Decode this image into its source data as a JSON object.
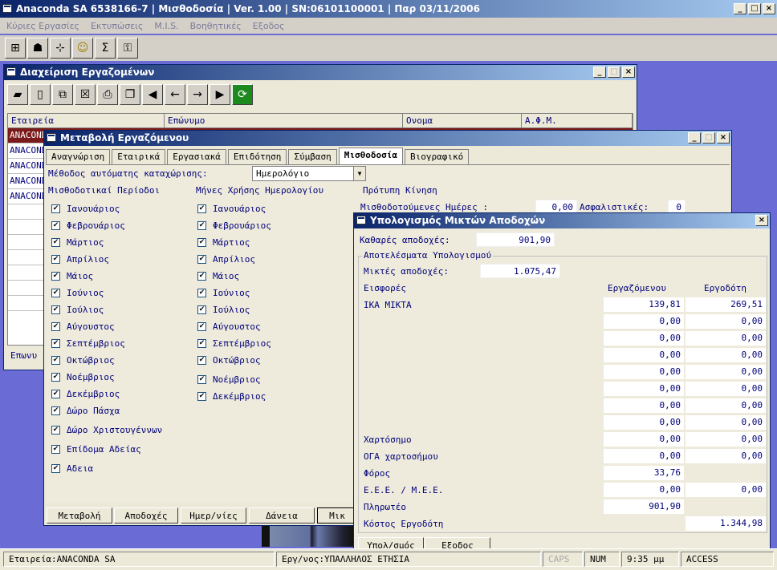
{
  "app": {
    "title": "Anaconda SA 6538166-7 | Μισθοδοσία | Ver. 1.00 | SN:06101100001 | Παρ 03/11/2006",
    "menu": [
      "Κύριες Εργασίες",
      "Εκτυπώσεις",
      "M.I.S.",
      "Βοηθητικές",
      "Εξοδος"
    ]
  },
  "status": {
    "company": "Εταιρεία:ANACONDA SA",
    "user": "Εργ/νος:ΥΠΑΛΛΗΛΟΣ ΕΤΗΣΙΑ",
    "caps": "CAPS",
    "num": "NUM",
    "time": "9:35 μμ",
    "mode": "ACCESS"
  },
  "employees": {
    "title": "Διαχείριση Εργαζομένων",
    "columns": [
      "Εταιρεία",
      "Επώνυμο",
      "Ονομα",
      "Α.Φ.Μ."
    ],
    "rows": [
      "ANACONDA",
      "ANACONDA",
      "ANACONDA",
      "ANACONDA",
      "ANACONDA"
    ],
    "search_label": "Επωνυ"
  },
  "edit": {
    "title": "Μεταβολή Εργαζόμενου",
    "tabs": [
      "Αναγνώριση",
      "Εταιρικά",
      "Εργασιακά",
      "Επιδότηση",
      "Σύμβαση",
      "Μισθοδοσία",
      "Βιογραφικό"
    ],
    "method_label": "Μέθοδος αυτόματης καταχώρισης:",
    "method_value": "Ημερολόγιο",
    "col1_header": "Μισθοδοτικαί Περίοδοι",
    "col2_header": "Μήνες Χρήσης Ημερολογίου",
    "col3_header": "Πρότυπη Κίνηση",
    "days_label": "Μισθοδοτούμενες Ημέρες :",
    "days_value": "0,00",
    "insurance_label": "Ασφαλιστικές:",
    "insurance_value": "0",
    "periods": [
      "Ιανουάριος",
      "Φεβρουάριος",
      "Μάρτιος",
      "Απρίλιος",
      "Μάιος",
      "Ιούνιος",
      "Ιούλιος",
      "Αύγουστος",
      "Σεπτέμβριος",
      "Οκτώβριος",
      "Νοέμβριος",
      "Δεκέμβριος",
      "Δώρο Πάσχα",
      "Δώρο Χριστουγέννων",
      "Επίδομα Αδείας",
      "Αδεια"
    ],
    "months": [
      "Ιανουάριος",
      "Φεβρουάριος",
      "Μάρτιος",
      "Απρίλιος",
      "Μάιος",
      "Ιούνιος",
      "Ιούλιος",
      "Αύγουστος",
      "Σεπτέμβριος",
      "Οκτώβριος",
      "Νοέμβριος",
      "Δεκέμβριος"
    ],
    "buttons": [
      "Μεταβολή",
      "Αποδοχές",
      "Ημερ/νίες",
      "Δάνεια",
      "Μικ"
    ]
  },
  "calc": {
    "title": "Υπολογισμός Μικτών Αποδοχών",
    "net_label": "Καθαρές αποδοχές:",
    "net_value": "901,90",
    "group_title": "Αποτελέσματα Υπολογισμού",
    "gross_label": "Μικτές αποδοχές:",
    "gross_value": "1.075,47",
    "contrib_header": "Εισφορές",
    "emp_header": "Εργαζόμενου",
    "empl_header": "Εργοδότη",
    "rows": [
      {
        "label": "ΙΚΑ ΜΙΚΤΑ",
        "emp": "139,81",
        "empl": "269,51"
      },
      {
        "label": "",
        "emp": "0,00",
        "empl": "0,00"
      },
      {
        "label": "",
        "emp": "0,00",
        "empl": "0,00"
      },
      {
        "label": "",
        "emp": "0,00",
        "empl": "0,00"
      },
      {
        "label": "",
        "emp": "0,00",
        "empl": "0,00"
      },
      {
        "label": "",
        "emp": "0,00",
        "empl": "0,00"
      },
      {
        "label": "",
        "emp": "0,00",
        "empl": "0,00"
      },
      {
        "label": "",
        "emp": "0,00",
        "empl": "0,00"
      },
      {
        "label": "Χαρτόσημο",
        "emp": "0,00",
        "empl": "0,00"
      },
      {
        "label": "ΟΓΑ χαρτοσήμου",
        "emp": "0,00",
        "empl": "0,00"
      },
      {
        "label": "Φόρος",
        "emp": "33,76",
        "empl": ""
      },
      {
        "label": "Ε.Ε.Ε. / Μ.Ε.Ε.",
        "emp": "0,00",
        "empl": "0,00"
      },
      {
        "label": "Πληρωτέο",
        "emp": "901,90",
        "empl": ""
      },
      {
        "label": "Κόστος Εργοδότη",
        "emp": "",
        "empl": "1.344,98"
      }
    ],
    "buttons": [
      "Υπολ/σμός",
      "Εξοδος"
    ]
  }
}
